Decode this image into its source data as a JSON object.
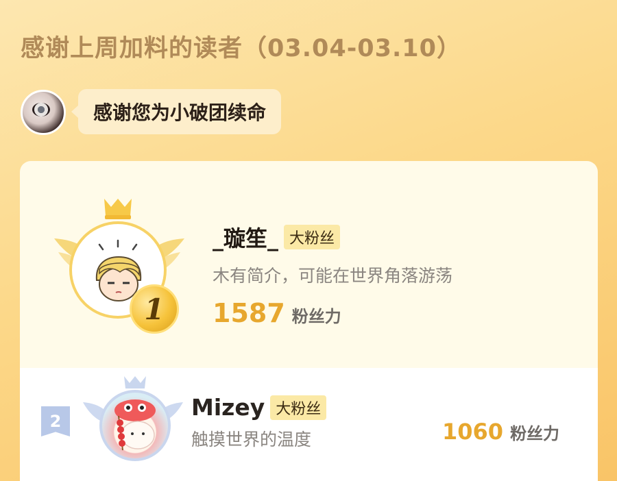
{
  "header": {
    "title": "感谢上周加料的读者（03.04-03.10）"
  },
  "author": {
    "message": "感谢您为小破团续命"
  },
  "ranking": [
    {
      "rank": "1",
      "name": "_璇笙_",
      "badge": "大粉丝",
      "intro": "木有简介，可能在世界角落游荡",
      "power_value": "1587",
      "power_unit": "粉丝力"
    },
    {
      "rank": "2",
      "name": "Mizey",
      "badge": "大粉丝",
      "intro": "触摸世界的温度",
      "power_value": "1060",
      "power_unit": "粉丝力"
    }
  ],
  "colors": {
    "accent": "#e7a72e",
    "badge_bg": "#fbe9a6",
    "rank2_blue": "#b8c8e8"
  }
}
